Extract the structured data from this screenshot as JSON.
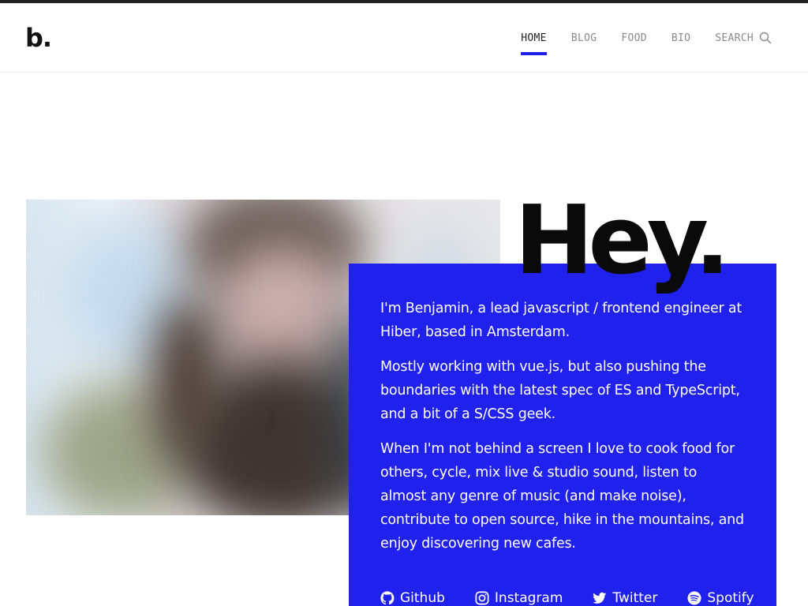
{
  "brand": {
    "logo": "b."
  },
  "nav": {
    "items": [
      {
        "label": "HOME",
        "active": true
      },
      {
        "label": "BLOG",
        "active": false
      },
      {
        "label": "FOOD",
        "active": false
      },
      {
        "label": "BIO",
        "active": false
      }
    ],
    "search_label": "SEARCH",
    "search_icon": "search-icon"
  },
  "hero": {
    "title": "Hey.",
    "paragraphs": [
      "I'm Benjamin, a lead javascript / frontend engineer at Hiber, based in Amsterdam.",
      "Mostly working with vue.js, but also pushing the boundaries with the latest spec of ES and TypeScript, and a bit of a S/CSS geek.",
      "When I'm not behind a screen I love to cook food for others, cycle, mix live & studio sound, listen to almost any genre of music (and make noise), contribute to open source, hike in the mountains, and enjoy discovering new cafes."
    ]
  },
  "socials": [
    {
      "label": "Github",
      "icon": "github-icon"
    },
    {
      "label": "Instagram",
      "icon": "instagram-icon"
    },
    {
      "label": "Twitter",
      "icon": "twitter-icon"
    },
    {
      "label": "Spotify",
      "icon": "spotify-icon"
    }
  ],
  "colors": {
    "accent": "#2121ee",
    "text_dark": "#111111",
    "nav_muted": "#8a8a8a"
  }
}
